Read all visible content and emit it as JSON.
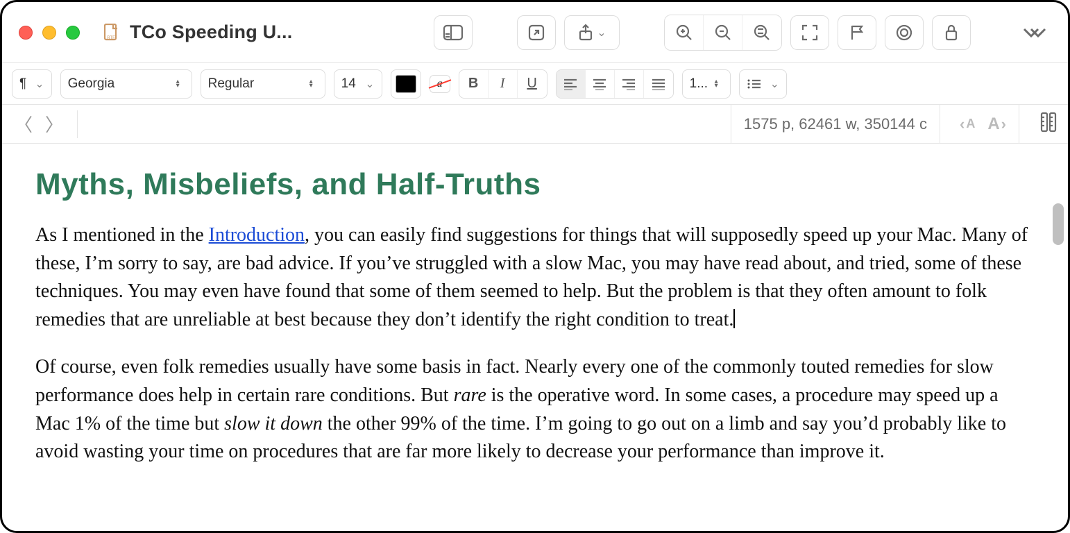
{
  "window": {
    "title": "TCo Speeding U...",
    "file_type_label": "RTF"
  },
  "toolbar": {
    "font_family": "Georgia",
    "font_style": "Regular",
    "font_size": "14",
    "line_spacing": "1...",
    "text_color": "#000000",
    "bold_label": "B",
    "italic_label": "I",
    "underline_label": "U"
  },
  "navrow": {
    "stats": "1575 p, 62461 w, 350144 c"
  },
  "document": {
    "heading": "Myths, Misbeliefs, and Half-Truths",
    "para1_a": "As I mentioned in the ",
    "para1_link": "Introduction",
    "para1_b": ", you can easily find suggestions for things that will supposedly speed up your Mac. Many of these, I’m sorry to say, are bad advice. If you’ve struggled with a slow Mac, you may have read about, and tried, some of these techniques. You may even have found that some of them seemed to help. But the problem is that they often amount to folk remedies that are unreliable at best because they don’t identify the right condition to treat.",
    "para2_a": "Of course, even folk remedies usually have some basis in fact. Nearly every one of the commonly touted remedies for slow performance does help in certain rare conditions. But ",
    "para2_em1": "rare",
    "para2_b": " is the operative word. In some cases, a procedure may speed up a Mac 1% of the time but ",
    "para2_em2": "slow it down",
    "para2_c": " the other 99% of the time. I’m going to go out on a limb and say you’d probably like to avoid wasting your time on procedures that are far more likely to decrease your performance than improve it."
  }
}
